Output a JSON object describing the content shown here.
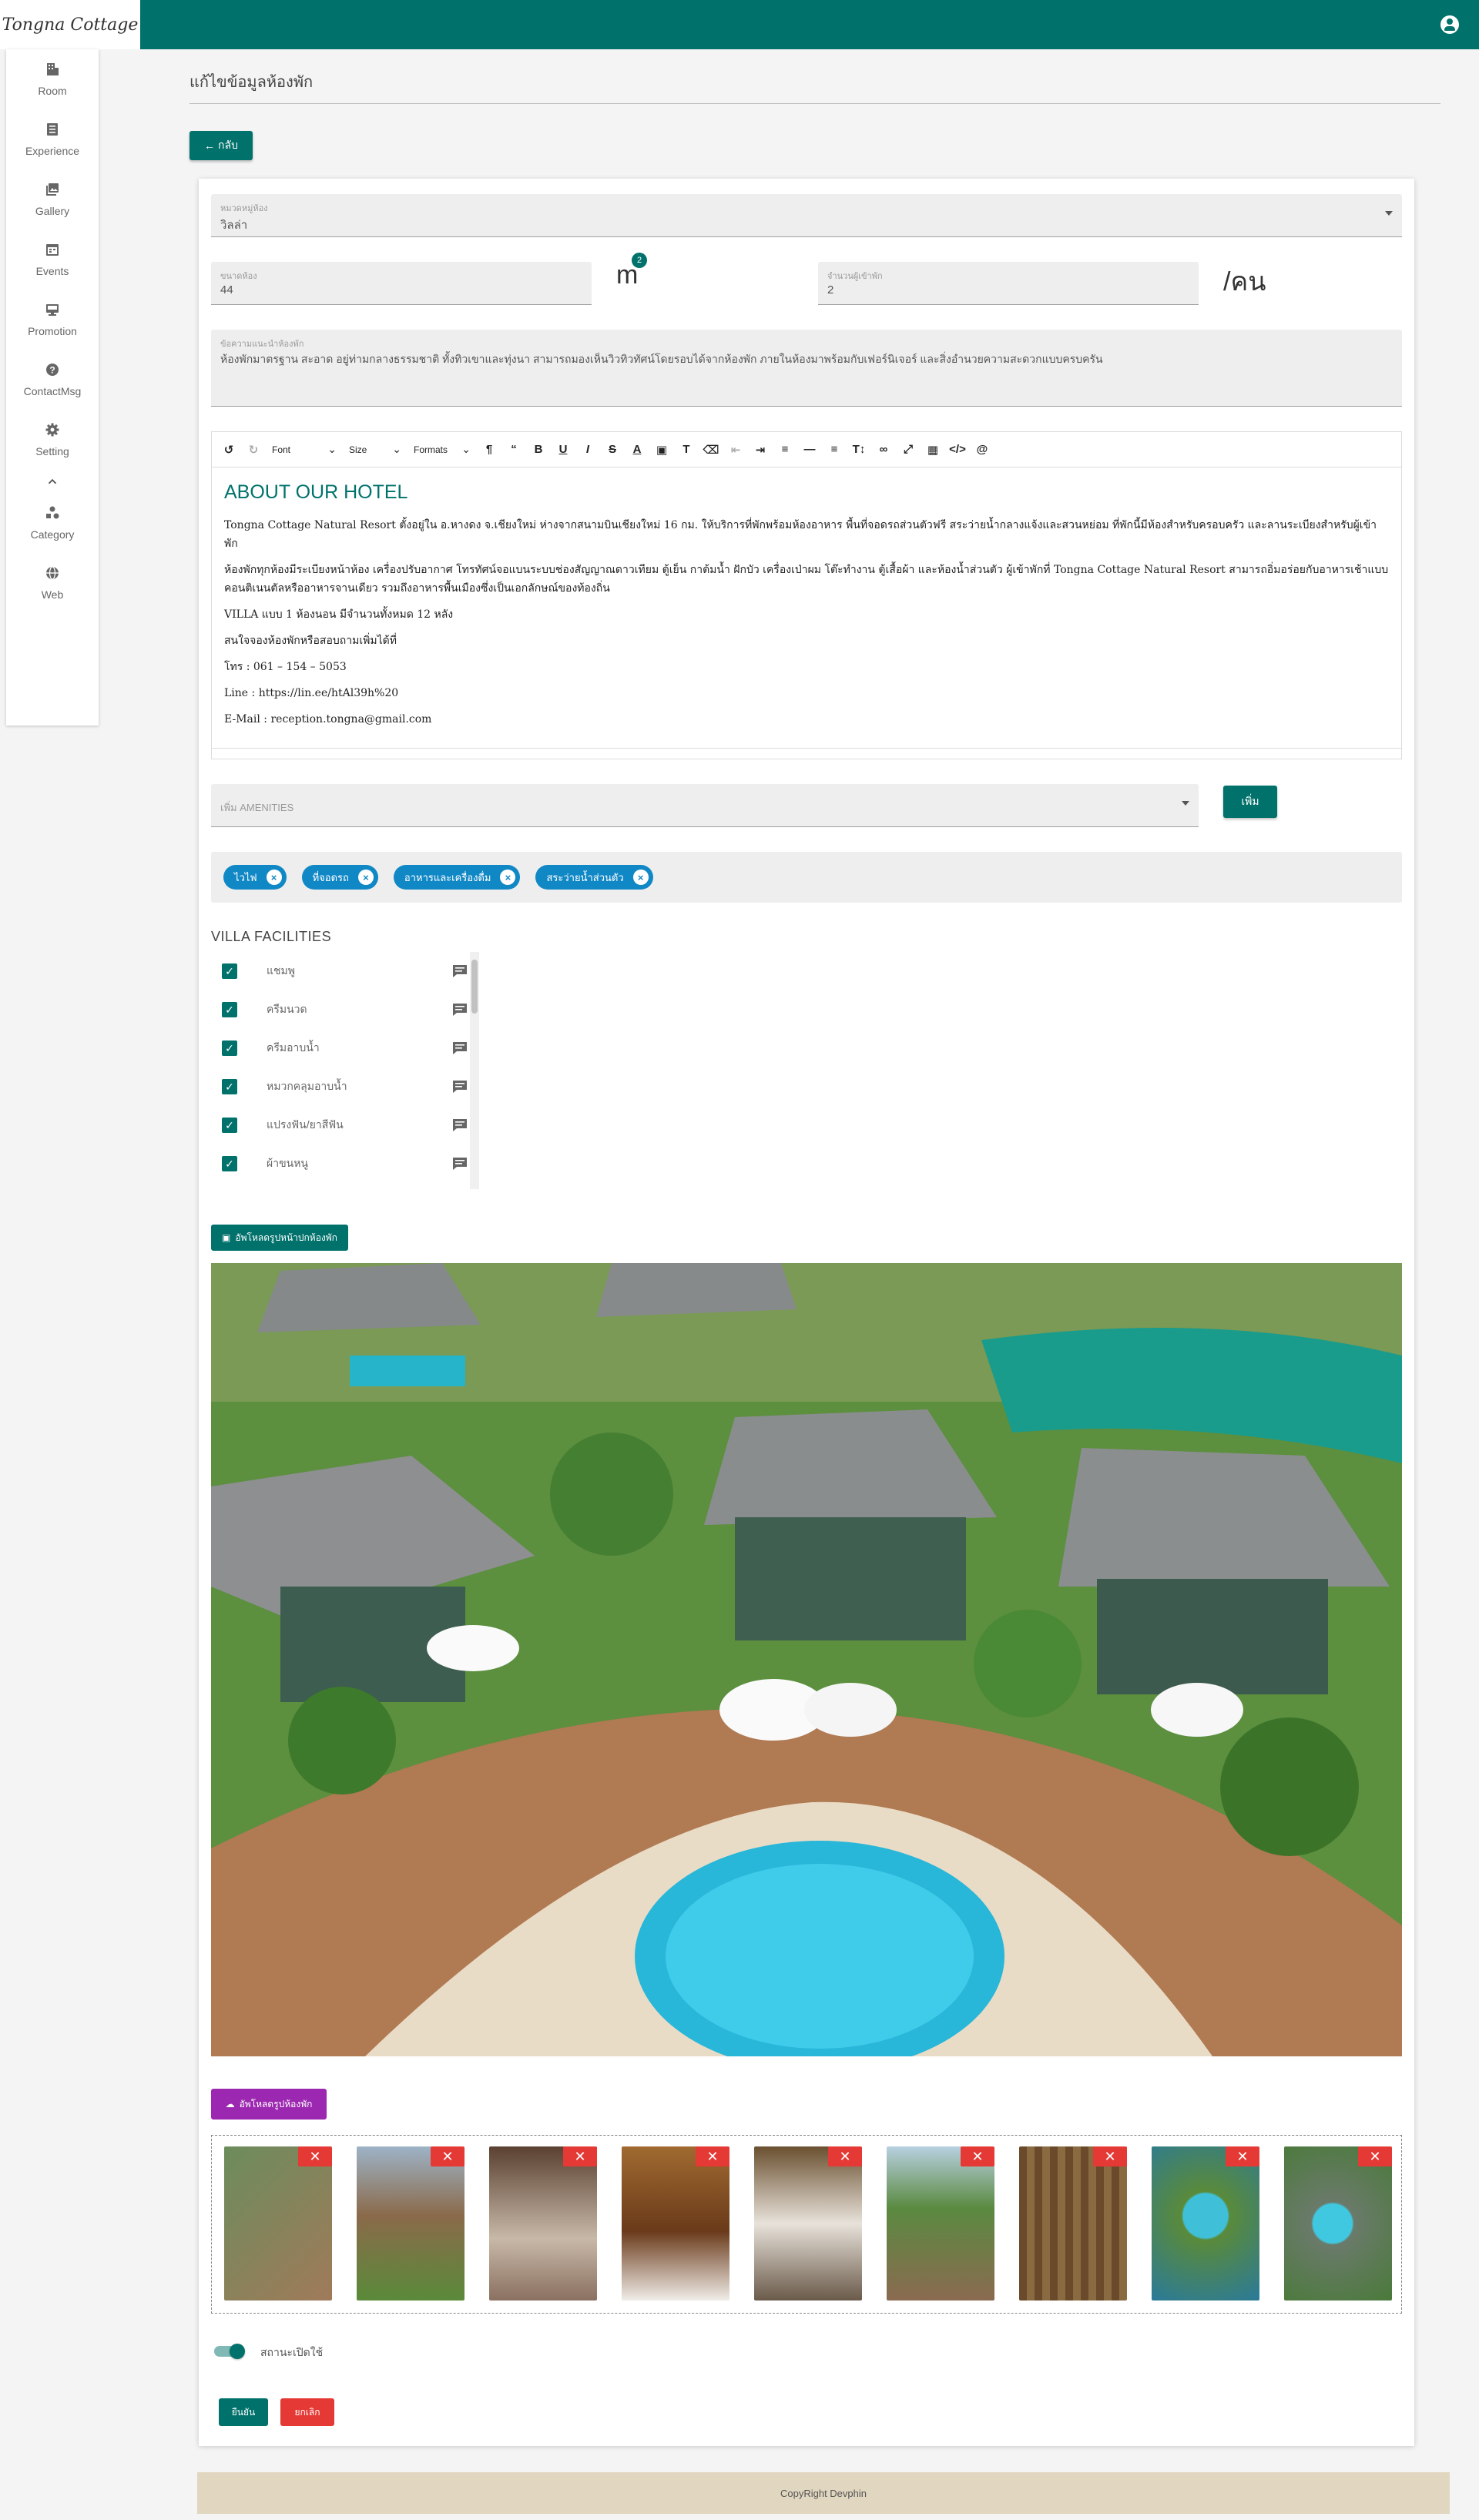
{
  "brand": {
    "logo_text": "Tongna Cottage",
    "accent": "#00716b"
  },
  "sidebar": {
    "items": [
      {
        "label": "Room",
        "icon": "building-icon"
      },
      {
        "label": "Experience",
        "icon": "list-icon"
      },
      {
        "label": "Gallery",
        "icon": "images-icon"
      },
      {
        "label": "Events",
        "icon": "calendar-icon"
      },
      {
        "label": "Promotion",
        "icon": "monitor-icon"
      },
      {
        "label": "ContactMsg",
        "icon": "question-icon"
      },
      {
        "label": "Setting",
        "icon": "gear-icon"
      },
      {
        "label": "Category",
        "icon": "shapes-icon"
      },
      {
        "label": "Web",
        "icon": "globe-icon"
      }
    ]
  },
  "page": {
    "title": "แก้ไขข้อมูลห้องพัก",
    "back_label": "กลับ"
  },
  "form": {
    "category": {
      "label": "หมวดหมู่ห้อง",
      "value": "วิลล่า"
    },
    "size": {
      "label": "ขนาดห้อง",
      "value": "44",
      "unit": "m",
      "superscript": "2"
    },
    "guests": {
      "label": "จำนวนผู้เข้าพัก",
      "value": "2",
      "unit": "/คน"
    },
    "description": {
      "label": "ข้อความแนะนำห้องพัก",
      "value": "ห้องพักมาตรฐาน สะอาด อยู่ท่ามกลางธรรมชาติ ทั้งทิวเขาและทุ่งนา สามารถมองเห็นวิวทิวทัศน์โดยรอบได้จากห้องพัก ภายในห้องมาพร้อมกับเฟอร์นิเจอร์ และสิ่งอำนวยความสะดวกแบบครบครัน"
    }
  },
  "editor": {
    "toolbar": {
      "font": "Font",
      "size": "Size",
      "formats": "Formats"
    },
    "heading": "ABOUT OUR HOTEL",
    "paragraphs": [
      "Tongna Cottage Natural Resort ตั้งอยู่ใน อ.หางดง จ.เชียงใหม่ ห่างจากสนามบินเชียงใหม่ 16 กม. ให้บริการที่พักพร้อมห้องอาหาร พื้นที่จอดรถส่วนตัวฟรี สระว่ายน้ำกลางแจ้งและสวนหย่อม ที่พักนี้มีห้องสำหรับครอบครัว และลานระเบียงสำหรับผู้เข้าพัก",
      "ห้องพักทุกห้องมีระเบียงหน้าห้อง เครื่องปรับอากาศ โทรทัศน์จอแบนระบบช่องสัญญาณดาวเทียม ตู้เย็น กาต้มน้ำ ฝักบัว เครื่องเป่าผม โต๊ะทำงาน ตู้เสื้อผ้า และห้องน้ำส่วนตัว ผู้เข้าพักที่ Tongna Cottage Natural Resort สามารถอิ่มอร่อยกับอาหารเช้าแบบคอนติเนนตัลหรืออาหารจานเดียว รวมถึงอาหารพื้นเมืองซึ่งเป็นเอกลักษณ์ของท้องถิ่น",
      "VILLA แบบ 1 ห้องนอน มีจำนวนทั้งหมด 12 หลัง",
      "สนใจจองห้องพักหรือสอบถามเพิ่มได้ที่",
      "โทร : 061 – 154 – 5053",
      "Line : https://lin.ee/htAl39h%20",
      "E-Mail : reception.tongna@gmail.com"
    ]
  },
  "amenities": {
    "select_placeholder": "เพิ่ม AMENITIES",
    "add_label": "เพิ่ม",
    "chips": [
      "ไวไฟ",
      "ที่จอดรถ",
      "อาหารและเครื่องดื่ม",
      "สระว่ายน้ำส่วนตัว"
    ]
  },
  "facilities": {
    "title": "VILLA FACILITIES",
    "items": [
      "แชมพู",
      "ครีมนวด",
      "ครีมอาบน้ำ",
      "หมวกคลุมอาบน้ำ",
      "แปรงฟัน/ยาสีฟัน",
      "ผ้าขนหนู"
    ]
  },
  "media": {
    "cover_button": "อัพโหลดรูปหน้าปกห้องพัก",
    "gallery_button": "อัพโหลดรูปห้องพัก",
    "gallery_count": 9
  },
  "status": {
    "label": "สถานะเปิดใช้",
    "enabled": true
  },
  "actions": {
    "confirm": "ยืนยัน",
    "cancel": "ยกเลิก"
  },
  "footer": {
    "text": "CopyRight Devphin"
  }
}
